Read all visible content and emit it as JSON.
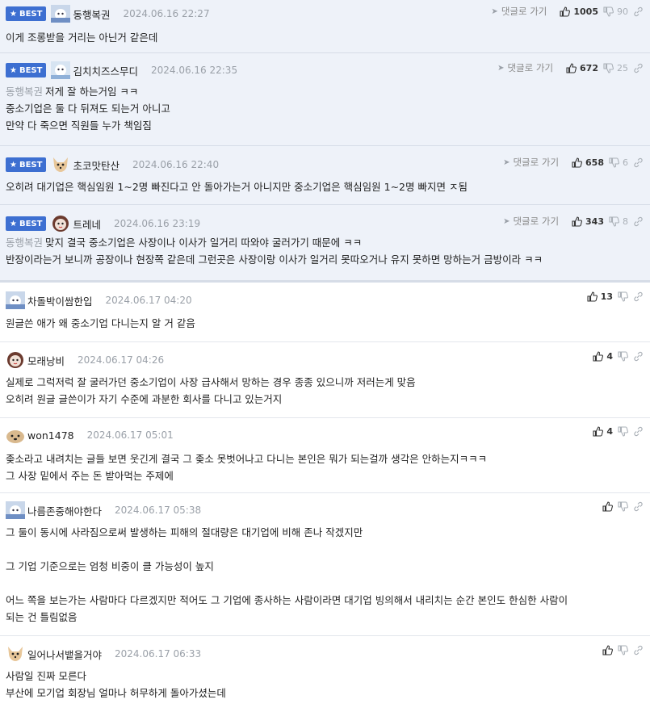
{
  "reply_label": "댓글로 가기",
  "best_label": "BEST",
  "comments": [
    {
      "best": true,
      "nick": "동행복권",
      "date": "2024.06.16 22:27",
      "up": "1005",
      "down": "90",
      "mention": "",
      "lines": [
        "이게 조롱받을 거리는 아닌거 같은데"
      ]
    },
    {
      "best": true,
      "nick": "김치치즈스무디",
      "date": "2024.06.16 22:35",
      "up": "672",
      "down": "25",
      "mention": "동행복권",
      "lines": [
        "저게 잘 하는거임 ㅋㅋ",
        "중소기업은 둘 다 뒤져도 되는거 아니고",
        "만약 다 죽으면 직원들 누가 책임짐"
      ]
    },
    {
      "best": true,
      "nick": "초코맛탄산",
      "date": "2024.06.16 22:40",
      "up": "658",
      "down": "6",
      "mention": "",
      "lines": [
        "오히려 대기업은 핵심임원 1~2명 빠진다고 안 돌아가는거 아니지만 중소기업은 핵심임원 1~2명 빠지면 ㅈ됨"
      ]
    },
    {
      "best": true,
      "nick": "트레네",
      "date": "2024.06.16 23:19",
      "up": "343",
      "down": "8",
      "mention": "동행복권",
      "lines": [
        "맞지 결국 중소기업은 사장이나 이사가 일거리 따와야 굴러가기 때문에 ㅋㅋ",
        "반장이라는거 보니까 공장이나 현장쪽 같은데 그런곳은 사장이랑 이사가 일거리 못따오거나 유지 못하면 망하는거 금방이라 ㅋㅋ"
      ]
    },
    {
      "best": false,
      "nick": "차돌박이쌈한입",
      "date": "2024.06.17 04:20",
      "up": "13",
      "down": "",
      "mention": "",
      "lines": [
        "원글쓴 애가 왜 중소기업 다니는지 알 거 같음"
      ]
    },
    {
      "best": false,
      "nick": "모래낭비",
      "date": "2024.06.17 04:26",
      "up": "4",
      "down": "",
      "mention": "",
      "lines": [
        "실제로 그럭저럭 잘 굴러가던 중소기업이 사장 급사해서 망하는 경우 종종 있으니까 저러는게 맞음",
        "오히려 원글 글쓴이가 자기 수준에 과분한 회사를 다니고 있는거지"
      ]
    },
    {
      "best": false,
      "nick": "won1478",
      "date": "2024.06.17 05:01",
      "up": "4",
      "down": "",
      "mention": "",
      "lines": [
        "좆소라고 내려치는 글들 보면 웃긴게 결국 그 좆소 못벗어나고 다니는 본인은 뭐가 되는걸까 생각은 안하는지ㅋㅋㅋ",
        "그 사장 밑에서 주는 돈 받아먹는 주제에"
      ]
    },
    {
      "best": false,
      "nick": "나름존중해야한다",
      "date": "2024.06.17 05:38",
      "up": "",
      "down": "",
      "mention": "",
      "lines": [
        "그 둘이 동시에 사라짐으로써 발생하는 피해의 절대량은 대기업에 비해 존나 작겠지만",
        "",
        "그 기업 기준으로는 엄청 비중이 클 가능성이 높지",
        "",
        "어느 쪽을 보는가는 사람마다 다르겠지만 적어도 그 기업에 종사하는 사람이라면 대기업 빙의해서 내리치는 순간 본인도 한심한 사람이",
        "되는 건 틀림없음"
      ]
    },
    {
      "best": false,
      "nick": "일어나서뱉을거야",
      "date": "2024.06.17 06:33",
      "up": "",
      "down": "",
      "mention": "",
      "lines": [
        "사람일 진짜 모른다",
        "부산에 모기업 회장님 얼마나 허무하게 돌아가셨는데"
      ]
    }
  ]
}
